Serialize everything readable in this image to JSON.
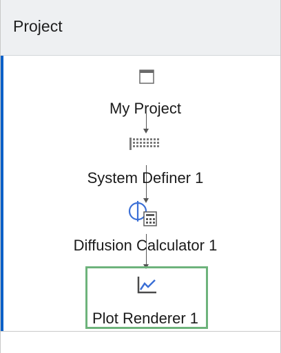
{
  "panel": {
    "title": "Project"
  },
  "nodes": [
    {
      "label": "My Project",
      "icon": "window-icon"
    },
    {
      "label": "System Definer 1",
      "icon": "grid-icon"
    },
    {
      "label": "Diffusion Calculator 1",
      "icon": "phi-calculator-icon"
    },
    {
      "label": "Plot Renderer 1",
      "icon": "line-chart-icon",
      "selected": true
    }
  ],
  "colors": {
    "selection_border": "#6db37b",
    "accent_edge": "#0a60c8",
    "icon_blue": "#3b6fd6"
  }
}
